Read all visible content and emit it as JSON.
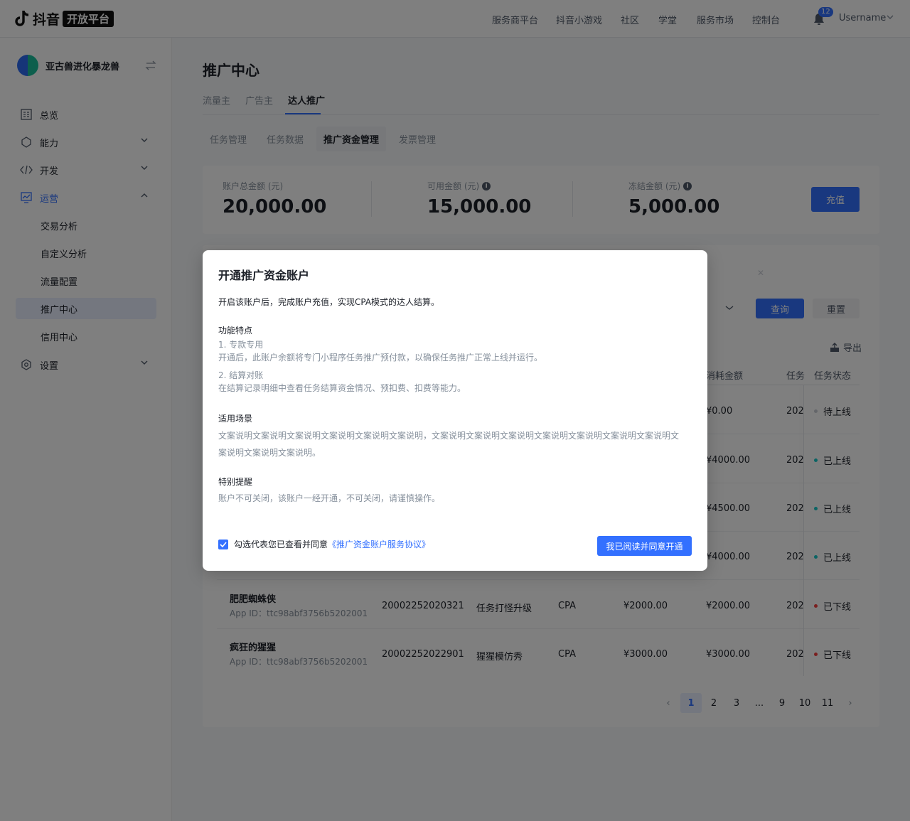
{
  "header": {
    "brand": "抖音",
    "brand_badge": "开放平台",
    "nav": [
      "服务商平台",
      "抖音小游戏",
      "社区",
      "学堂",
      "服务市场",
      "控制台"
    ],
    "notification_count": "12",
    "username": "Username"
  },
  "sidebar": {
    "org_name": "亚古兽进化暴龙兽",
    "items": [
      {
        "label": "总览",
        "icon": "dashboard-icon"
      },
      {
        "label": "能力",
        "icon": "ability-icon"
      },
      {
        "label": "开发",
        "icon": "code-icon"
      },
      {
        "label": "运营",
        "icon": "operation-chart-icon"
      },
      {
        "label": "设置",
        "icon": "settings-gear-icon"
      }
    ],
    "submenu": [
      "交易分析",
      "自定义分析",
      "流量配置",
      "推广中心",
      "信用中心"
    ]
  },
  "main": {
    "title": "推广中心",
    "tabs": [
      "流量主",
      "广告主",
      "达人推广"
    ],
    "subtabs": [
      "任务管理",
      "任务数据",
      "推广资金管理",
      "发票管理"
    ],
    "summary": {
      "total_label": "账户总金额 (元)",
      "total_value": "20,000.00",
      "available_label": "可用金额 (元)",
      "available_value": "15,000.00",
      "frozen_label": "冻结金额 (元)",
      "frozen_value": "5,000.00",
      "recharge": "充值"
    },
    "query": "查询",
    "reset": "重置",
    "export": "导出",
    "columns": [
      "消耗金额",
      "任务",
      "任务状态"
    ],
    "rows": [
      {
        "consumed": "¥0.00",
        "date": "202",
        "status": "待上线",
        "status_color": "#c9cdd4"
      },
      {
        "consumed": "¥4000.00",
        "date": "202",
        "status": "已上线",
        "status_color": "#14c9c9"
      },
      {
        "consumed": "¥4500.00",
        "date": "202",
        "status": "已上线",
        "status_color": "#14c9c9"
      },
      {
        "consumed": "¥4000.00",
        "date": "202",
        "status": "已上线",
        "status_color": "#14c9c9"
      },
      {
        "name": "肥肥蜘蛛侠",
        "appid": "App ID：ttc98abf3756b5202001",
        "task_id": "20002252020321",
        "task_name": "任务打怪升级",
        "mode": "CPA",
        "budget": "¥2000.00",
        "consumed": "¥2000.00",
        "date": "202",
        "status": "已下线",
        "status_color": "#f53f3f"
      },
      {
        "name": "疯狂的猩猩",
        "appid": "App ID：ttc98abf3756b5202001",
        "task_id": "20002252022901",
        "task_name": "猩猩模仿秀",
        "mode": "CPA",
        "budget": "¥3000.00",
        "consumed": "¥3000.00",
        "date": "202",
        "status": "已下线",
        "status_color": "#f53f3f"
      }
    ],
    "pagination": [
      "1",
      "2",
      "3",
      "...",
      "9",
      "10",
      "11"
    ]
  },
  "modal": {
    "title": "开通推广资金账户",
    "desc": "开启该账户后，完成账户充值，实现CPA模式的达人结算。",
    "features_title": "功能特点",
    "feature1_title": "1. 专款专用",
    "feature1_text": "开通后，此账户余额将专门小程序任务推广预付款，以确保任务推广正常上线并运行。",
    "feature2_title": "2. 结算对账",
    "feature2_text": "在结算记录明细中查看任务结算资金情况、预扣费、扣费等能力。",
    "scene_title": "适用场景",
    "scene_text": "文案说明文案说明文案说明文案说明文案说明文案说明，文案说明文案说明文案说明文案说明文案说明文案说明文案说明文案说明文案说明文案说明。",
    "notice_title": "特别提醒",
    "notice_text": "账户不可关闭，该账户一经开通，不可关闭，请谨慎操作。",
    "agree_text": "勾选代表您已查看并同意",
    "agree_link": "《推广资金账户服务协议》",
    "confirm": "我已阅读并同意开通"
  }
}
